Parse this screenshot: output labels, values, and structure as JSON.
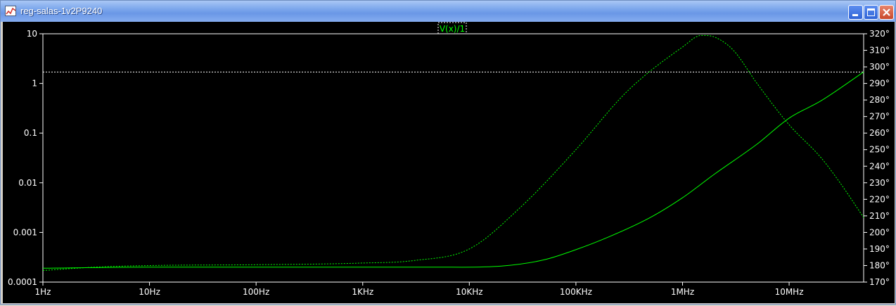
{
  "window": {
    "title": "reg-salas-1v2P9240",
    "icon": "waveform-icon",
    "buttons": [
      "minimize-icon",
      "maximize-icon",
      "close-icon"
    ]
  },
  "colors": {
    "background": "#000000",
    "trace": "#00ff00",
    "axis": "#ffffff",
    "titlebar": "#7ba6ec"
  },
  "chart_data": {
    "type": "line",
    "trace_label": "V(x)/1",
    "x_scale": "log",
    "xlim": [
      1,
      50000000
    ],
    "x_ticks": [
      "1Hz",
      "10Hz",
      "100Hz",
      "1KHz",
      "10KHz",
      "100KHz",
      "1MHz",
      "10MHz"
    ],
    "y_left_scale": "log",
    "ylim_left": [
      0.0001,
      10
    ],
    "y_left_ticks": [
      "10",
      "1",
      "0.1",
      "0.01",
      "0.001",
      "0.0001"
    ],
    "ylim_right": [
      170,
      320
    ],
    "y_right_ticks": [
      "320°",
      "310°",
      "300°",
      "290°",
      "280°",
      "270°",
      "260°",
      "250°",
      "240°",
      "230°",
      "220°",
      "210°",
      "200°",
      "190°",
      "180°",
      "170°"
    ],
    "cursor_level": 1.7,
    "series": [
      {
        "style": "solid",
        "axis": "left",
        "points": [
          [
            1,
            0.00019
          ],
          [
            10,
            0.0002
          ],
          [
            100,
            0.0002
          ],
          [
            1000,
            0.0002
          ],
          [
            5000,
            0.0002
          ],
          [
            20000,
            0.00021
          ],
          [
            50000,
            0.00028
          ],
          [
            100000,
            0.00045
          ],
          [
            200000,
            0.0008
          ],
          [
            500000,
            0.002
          ],
          [
            1000000,
            0.005
          ],
          [
            2000000,
            0.015
          ],
          [
            5000000,
            0.06
          ],
          [
            10000000,
            0.2
          ],
          [
            20000000,
            0.45
          ],
          [
            50000000,
            1.7
          ]
        ]
      },
      {
        "style": "dashed",
        "axis": "right",
        "points": [
          [
            1,
            177
          ],
          [
            3,
            179
          ],
          [
            10,
            180
          ],
          [
            100,
            180.5
          ],
          [
            1000,
            181.5
          ],
          [
            3000,
            183
          ],
          [
            10000,
            190
          ],
          [
            30000,
            215
          ],
          [
            100000,
            250
          ],
          [
            300000,
            285
          ],
          [
            1000000,
            312
          ],
          [
            1500000,
            319
          ],
          [
            2000000,
            318
          ],
          [
            3000000,
            310
          ],
          [
            5000000,
            290
          ],
          [
            10000000,
            265
          ],
          [
            20000000,
            245
          ],
          [
            30000000,
            230
          ],
          [
            50000000,
            209
          ]
        ]
      }
    ]
  }
}
